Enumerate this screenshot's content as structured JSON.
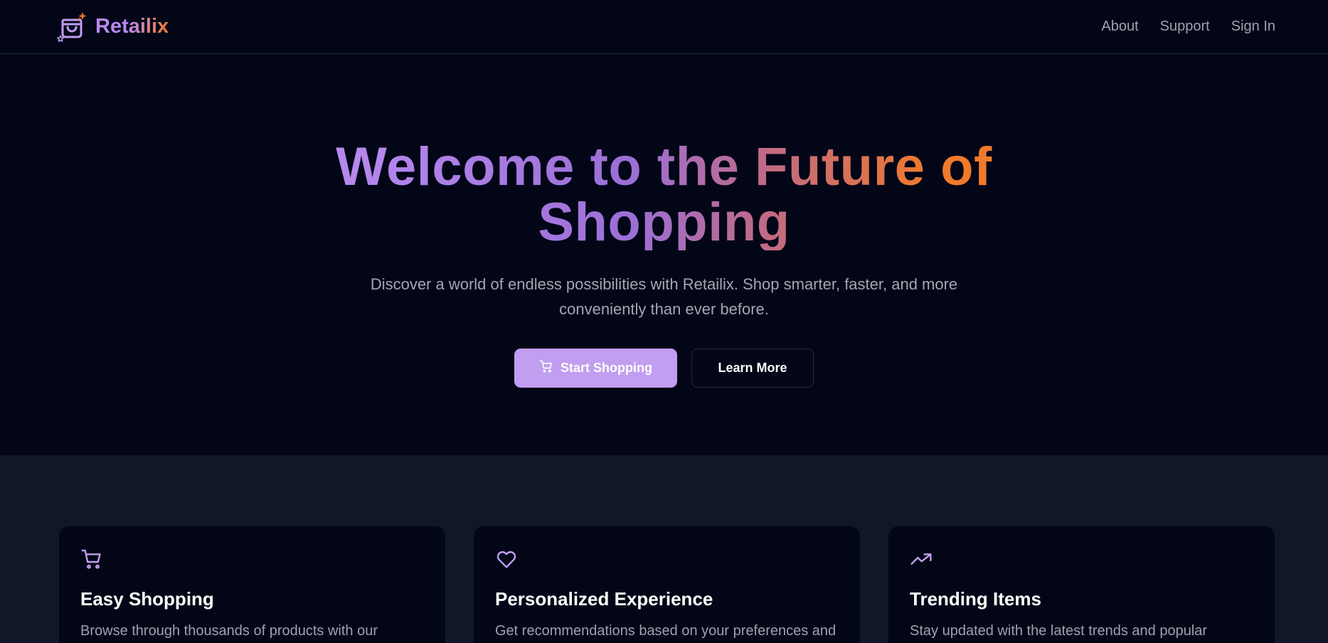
{
  "brand": {
    "name": "Retailix",
    "logo_icon": "shopping-bag-sparkle-icon",
    "gradient_from": "#b88af0",
    "gradient_to": "#f07a2b"
  },
  "nav": {
    "links": [
      "About",
      "Support",
      "Sign In"
    ]
  },
  "hero": {
    "title": "Welcome to the Future of Shopping",
    "subtitle": "Discover a world of endless possibilities with Retailix. Shop smarter, faster, and more conveniently than ever before.",
    "primary_button": {
      "label": "Start Shopping",
      "icon": "shopping-cart-icon"
    },
    "secondary_button": {
      "label": "Learn More"
    }
  },
  "features": [
    {
      "icon": "shopping-cart-icon",
      "title": "Easy Shopping",
      "description": "Browse through thousands of products with our intuitive interface."
    },
    {
      "icon": "heart-icon",
      "title": "Personalized Experience",
      "description": "Get recommendations based on your preferences and history."
    },
    {
      "icon": "trending-up-icon",
      "title": "Trending Items",
      "description": "Stay updated with the latest trends and popular products."
    }
  ],
  "colors": {
    "background": "#020617",
    "section_background": "#0f1729",
    "accent": "#c19ef0",
    "text_muted": "#9ca3af"
  }
}
